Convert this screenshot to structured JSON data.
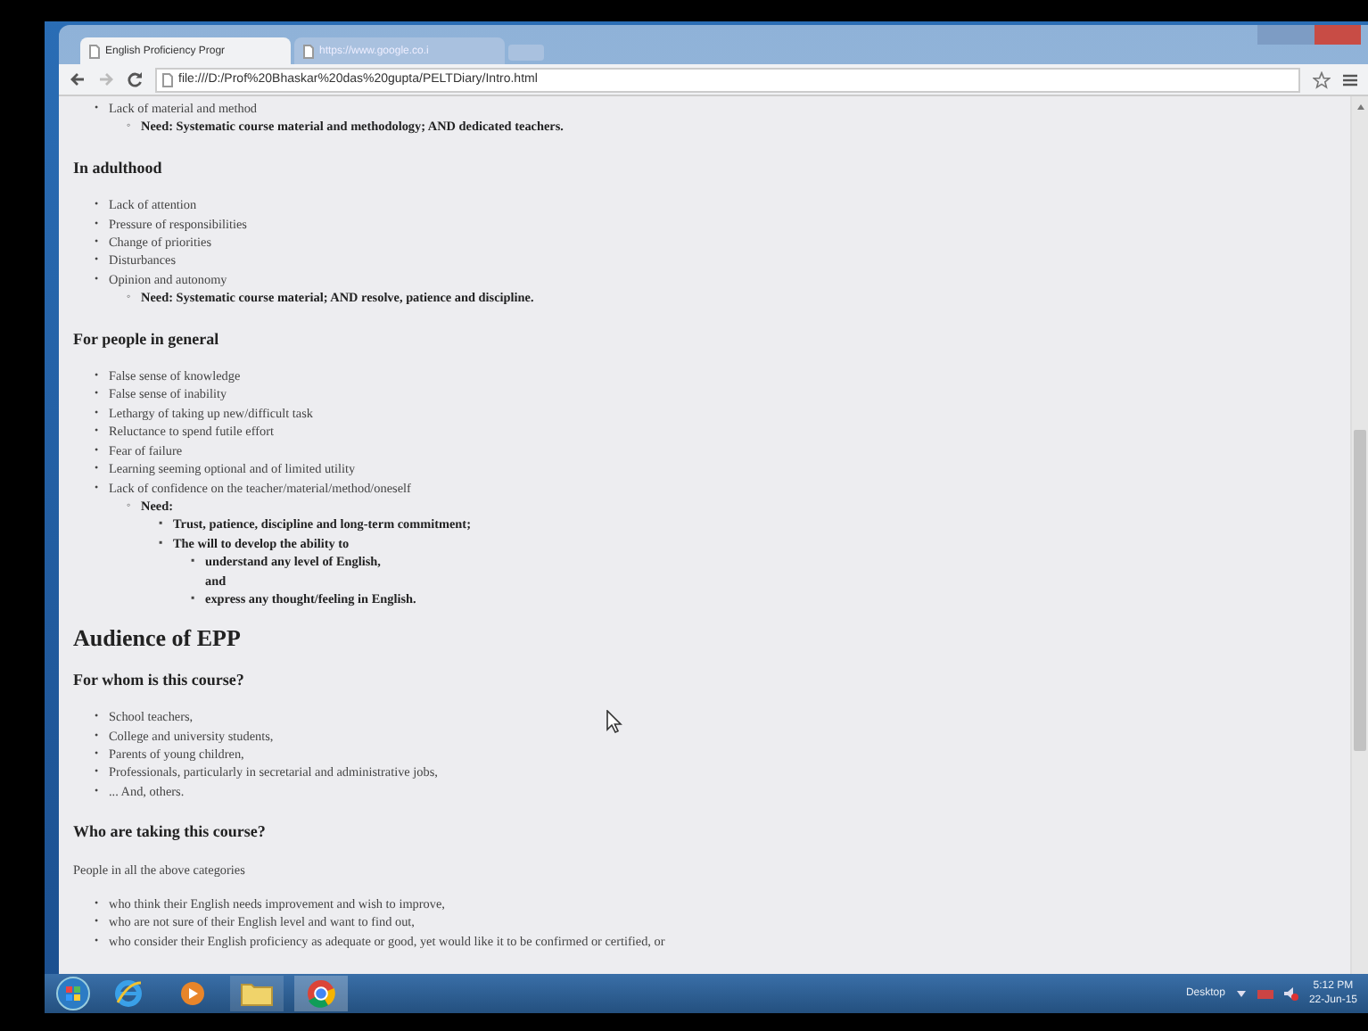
{
  "tabs": [
    {
      "label": "English Proficiency Progr",
      "selected": true
    },
    {
      "label": "https://www.google.co.i",
      "selected": false
    }
  ],
  "address": "file:///D:/Prof%20Bhaskar%20das%20gupta/PELTDiary/Intro.html",
  "content": [
    {
      "kind": "list",
      "items": [
        {
          "marker": "•",
          "text": "Lack of material and method",
          "bold": false,
          "children": [
            {
              "marker": "◦",
              "text": "Need: Systematic course material and methodology; AND dedicated teachers.",
              "bold": true
            }
          ]
        }
      ]
    },
    {
      "kind": "heading",
      "text": "In adulthood"
    },
    {
      "kind": "list",
      "items": [
        {
          "marker": "•",
          "text": "Lack of attention",
          "bold": false
        },
        {
          "marker": "•",
          "text": "Pressure of responsibilities",
          "bold": false
        },
        {
          "marker": "•",
          "text": "Change of priorities",
          "bold": false
        },
        {
          "marker": "•",
          "text": "Disturbances",
          "bold": false
        },
        {
          "marker": "•",
          "text": "Opinion and autonomy",
          "bold": false,
          "children": [
            {
              "marker": "◦",
              "text": "Need: Systematic course material; AND resolve, patience and discipline.",
              "bold": true
            }
          ]
        }
      ]
    },
    {
      "kind": "heading",
      "text": "For people in general"
    },
    {
      "kind": "list",
      "items": [
        {
          "marker": "•",
          "text": "False sense of knowledge",
          "bold": false
        },
        {
          "marker": "•",
          "text": "False sense of inability",
          "bold": false
        },
        {
          "marker": "•",
          "text": "Lethargy of taking up new/difficult task",
          "bold": false
        },
        {
          "marker": "•",
          "text": "Reluctance to spend futile effort",
          "bold": false
        },
        {
          "marker": "•",
          "text": "Fear of failure",
          "bold": false
        },
        {
          "marker": "•",
          "text": "Learning seeming optional and of limited utility",
          "bold": false
        },
        {
          "marker": "•",
          "text": "Lack of confidence on the teacher/material/method/oneself",
          "bold": false,
          "children": [
            {
              "marker": "◦",
              "text": "Need:",
              "bold": true,
              "children": [
                {
                  "marker": "▪",
                  "text": "Trust, patience, discipline and long-term commitment;",
                  "bold": true
                },
                {
                  "marker": "▪",
                  "text": "The will to develop the ability to",
                  "bold": true,
                  "children": [
                    {
                      "marker": "▪",
                      "text": "understand any level of English,\nand",
                      "bold": true
                    },
                    {
                      "marker": "▪",
                      "text": "express any thought/feeling in English.",
                      "bold": true
                    }
                  ]
                }
              ]
            }
          ]
        }
      ]
    },
    {
      "kind": "title",
      "text": "Audience of EPP"
    },
    {
      "kind": "heading",
      "text": "For whom is this course?"
    },
    {
      "kind": "list",
      "items": [
        {
          "marker": "•",
          "text": "School teachers,",
          "bold": false
        },
        {
          "marker": "•",
          "text": "College and university students,",
          "bold": false
        },
        {
          "marker": "•",
          "text": "Parents of young children,",
          "bold": false
        },
        {
          "marker": "•",
          "text": "Professionals, particularly in secretarial and administrative jobs,",
          "bold": false
        },
        {
          "marker": "•",
          "text": "... And, others.",
          "bold": false
        }
      ]
    },
    {
      "kind": "heading",
      "text": "Who are taking this course?"
    },
    {
      "kind": "paragraph",
      "text": "People in all the above categories"
    },
    {
      "kind": "list",
      "items": [
        {
          "marker": "•",
          "text": "who think their English needs improvement and wish to improve,",
          "bold": false
        },
        {
          "marker": "•",
          "text": "who are not sure of their English level and want to find out,",
          "bold": false
        },
        {
          "marker": "•",
          "text": "who consider their English proficiency as adequate or good, yet would like it to be confirmed or certified, or",
          "bold": false
        }
      ]
    }
  ],
  "taskbar": {
    "toolbar_label": "Desktop",
    "time": "5:12 PM",
    "date": "22-Jun-15"
  }
}
